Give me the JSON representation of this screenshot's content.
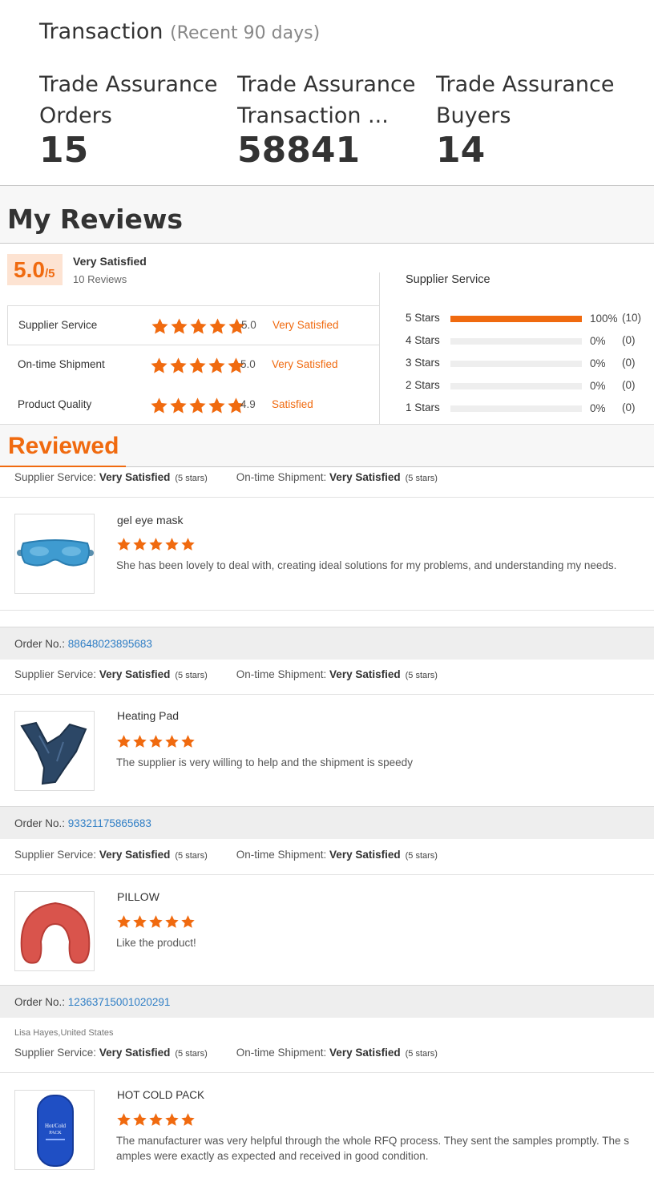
{
  "transaction": {
    "title": "Transaction",
    "subtitle": "(Recent 90 days)",
    "stats": [
      {
        "label1": "Trade Assurance",
        "label2": "Orders",
        "value": "15"
      },
      {
        "label1": "Trade Assurance",
        "label2": "Transaction ...",
        "value": "58841"
      },
      {
        "label1": "Trade Assurance",
        "label2": "Buyers",
        "value": "14"
      }
    ]
  },
  "my_reviews": {
    "heading": "My Reviews",
    "score": "5.0",
    "score_den": "/5",
    "overall_label": "Very Satisfied",
    "review_count": "10 Reviews",
    "ratings": [
      {
        "label": "Supplier Service",
        "value": "5.0",
        "text": "Very Satisfied",
        "stars": 5
      },
      {
        "label": "On-time Shipment",
        "value": "5.0",
        "text": "Very Satisfied",
        "stars": 5
      },
      {
        "label": "Product Quality",
        "value": "4.9",
        "text": "Satisfied",
        "stars": 5
      }
    ],
    "distribution": {
      "title": "Supplier Service",
      "rows": [
        {
          "label": "5  Stars",
          "fraction": 1.0,
          "pct": "100%",
          "count": "(10)"
        },
        {
          "label": "4  Stars",
          "fraction": 0,
          "pct": "0%",
          "count": "(0)"
        },
        {
          "label": "3  Stars",
          "fraction": 0,
          "pct": "0%",
          "count": "(0)"
        },
        {
          "label": "2  Stars",
          "fraction": 0,
          "pct": "0%",
          "count": "(0)"
        },
        {
          "label": "1  Stars",
          "fraction": 0,
          "pct": "0%",
          "count": "(0)"
        }
      ]
    }
  },
  "reviewed": {
    "heading": "Reviewed",
    "service_label": "Supplier Service:",
    "shipment_label": "On-time Shipment:",
    "very_satisfied": "Very Satisfied",
    "five_stars": "(5 stars)",
    "order_label": "Order No.:",
    "items": [
      {
        "order_no": "",
        "reviewer": "",
        "product": "gel eye mask",
        "comment": "She has been lovely to deal with, creating ideal solutions for my problems, and understanding my needs.",
        "stars": 5
      },
      {
        "order_no": "88648023895683",
        "reviewer": "",
        "product": "Heating Pad",
        "comment": "The supplier is very willing to help and the shipment is speedy",
        "stars": 5
      },
      {
        "order_no": "93321175865683",
        "reviewer": "",
        "product": "PILLOW",
        "comment": "Like the product!",
        "stars": 5
      },
      {
        "order_no": "12363715001020291",
        "reviewer": "Lisa Hayes,United States",
        "product": "HOT COLD PACK",
        "comment": "The manufacturer was very helpful through the whole RFQ process. They sent the samples promptly.  The s amples were exactly as expected and received in good condition.",
        "stars": 5
      }
    ],
    "pack_label_line1": "Hot/Cold",
    "pack_label_line2": "PACK"
  },
  "colors": {
    "accent": "#f06a0f",
    "link": "#2f7ec5",
    "score_bg": "#fde3d2"
  }
}
